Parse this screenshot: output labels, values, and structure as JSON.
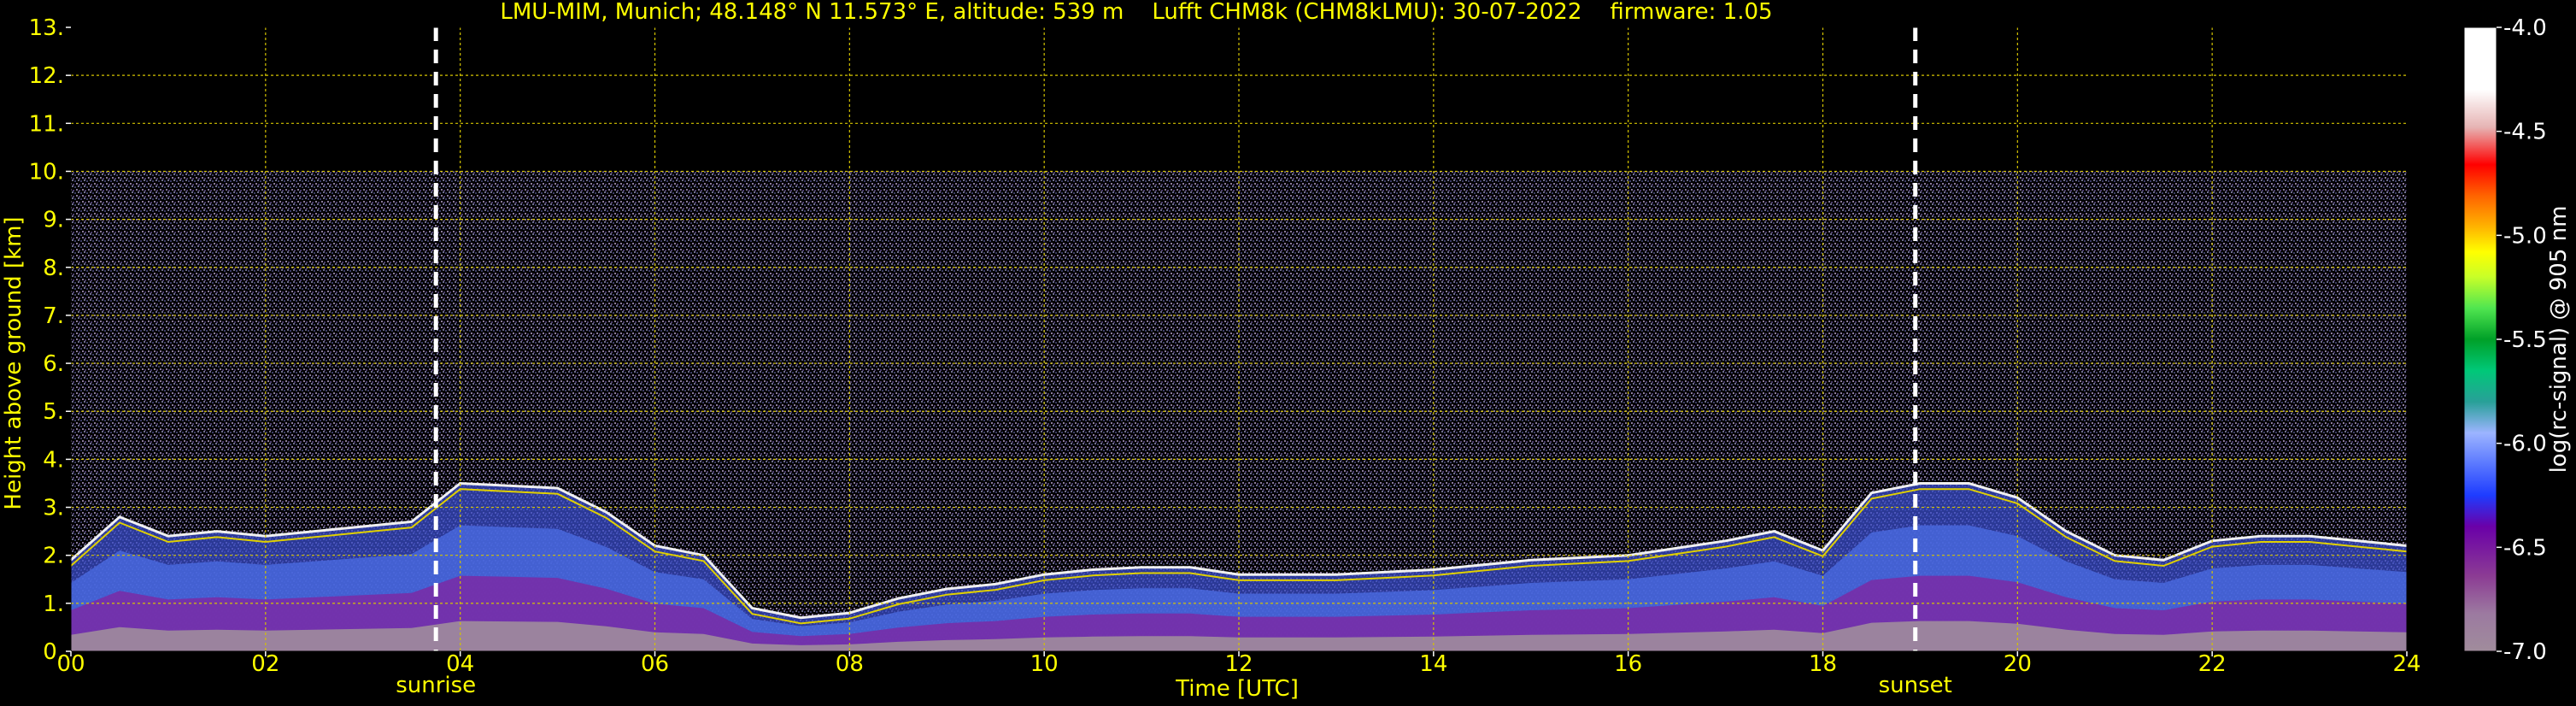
{
  "chart_data": {
    "type": "heatmap",
    "title": "LMU-MIM, Munich; 48.148° N 11.573° E, altitude: 539 m    Lufft CHM8k (CHM8kLMU): 30-07-2022    firmware: 1.05",
    "xlabel": "Time [UTC]",
    "ylabel": "Height above ground [km]",
    "colorbar_label": "log(rc-signal) @ 905 nm",
    "xlim": [
      0,
      24
    ],
    "ylim": [
      0,
      13
    ],
    "x_ticks": [
      0,
      2,
      4,
      6,
      8,
      10,
      12,
      14,
      16,
      18,
      20,
      22,
      24
    ],
    "x_tick_labels": [
      "00",
      "02",
      "04",
      "06",
      "08",
      "10",
      "12",
      "14",
      "16",
      "18",
      "20",
      "22",
      "24"
    ],
    "y_ticks": [
      0,
      1,
      2,
      3,
      4,
      5,
      6,
      7,
      8,
      9,
      10,
      11,
      12,
      13
    ],
    "y_tick_labels": [
      "0.",
      "1.",
      "2.",
      "3.",
      "4.",
      "5.",
      "6.",
      "7.",
      "8.",
      "9.",
      "10.",
      "11.",
      "12.",
      "13."
    ],
    "grid": true,
    "signal_top_km": 10,
    "colorbar": {
      "range": [
        -7.0,
        -4.0
      ],
      "ticks": [
        -4.0,
        -4.5,
        -5.0,
        -5.5,
        -6.0,
        -6.5,
        -7.0
      ],
      "tick_labels": [
        "-4.0",
        "-4.5",
        "-5.0",
        "-5.5",
        "-6.0",
        "-6.5",
        "-7.0"
      ]
    },
    "markers": [
      {
        "label": "sunrise",
        "time_utc": 3.75
      },
      {
        "label": "sunset",
        "time_utc": 18.95
      }
    ],
    "cloud_layer_top_km": [
      [
        0.0,
        1.9
      ],
      [
        0.5,
        2.8
      ],
      [
        1.0,
        2.4
      ],
      [
        1.5,
        2.5
      ],
      [
        2.0,
        2.4
      ],
      [
        2.5,
        2.5
      ],
      [
        3.0,
        2.6
      ],
      [
        3.5,
        2.7
      ],
      [
        4.0,
        3.5
      ],
      [
        4.5,
        3.45
      ],
      [
        5.0,
        3.4
      ],
      [
        5.5,
        2.9
      ],
      [
        6.0,
        2.2
      ],
      [
        6.5,
        2.0
      ],
      [
        7.0,
        0.9
      ],
      [
        7.5,
        0.7
      ],
      [
        8.0,
        0.8
      ],
      [
        8.5,
        1.1
      ],
      [
        9.0,
        1.3
      ],
      [
        9.5,
        1.4
      ],
      [
        10.0,
        1.6
      ],
      [
        10.5,
        1.7
      ],
      [
        11.0,
        1.75
      ],
      [
        11.5,
        1.75
      ],
      [
        12.0,
        1.6
      ],
      [
        13.0,
        1.6
      ],
      [
        14.0,
        1.7
      ],
      [
        15.0,
        1.9
      ],
      [
        16.0,
        2.0
      ],
      [
        17.0,
        2.3
      ],
      [
        17.5,
        2.5
      ],
      [
        18.0,
        2.1
      ],
      [
        18.5,
        3.3
      ],
      [
        19.0,
        3.5
      ],
      [
        19.5,
        3.5
      ],
      [
        20.0,
        3.2
      ],
      [
        20.5,
        2.5
      ],
      [
        21.0,
        2.0
      ],
      [
        21.5,
        1.9
      ],
      [
        22.0,
        2.3
      ],
      [
        22.5,
        2.4
      ],
      [
        23.0,
        2.4
      ],
      [
        23.5,
        2.3
      ],
      [
        24.0,
        2.2
      ]
    ],
    "colors": {
      "background": "#000000",
      "text": "#ffff00",
      "grid": "#d4c400",
      "marker": "#ffffff"
    }
  }
}
